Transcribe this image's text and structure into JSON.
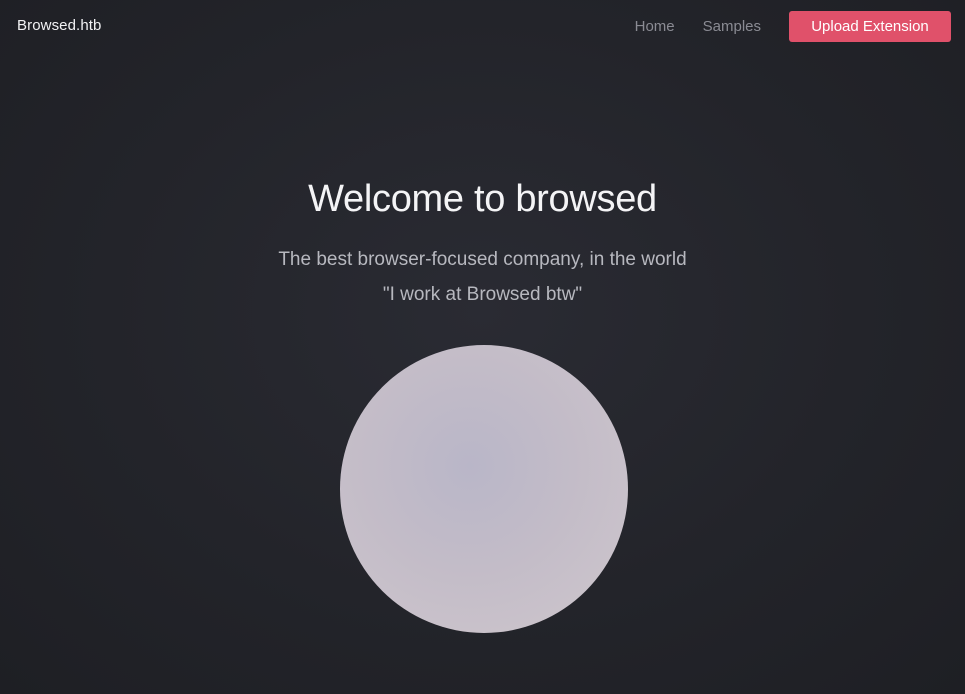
{
  "navbar": {
    "brand": "Browsed.htb",
    "links": [
      {
        "label": "Home"
      },
      {
        "label": "Samples"
      }
    ],
    "upload_button": "Upload Extension"
  },
  "hero": {
    "title": "Welcome to browsed",
    "subtitle": "The best browser-focused company, in the world",
    "quote": "\"I work at Browsed btw\""
  },
  "colors": {
    "background": "#23242a",
    "accent": "#e0516a",
    "nav_link": "#8a8b93"
  }
}
